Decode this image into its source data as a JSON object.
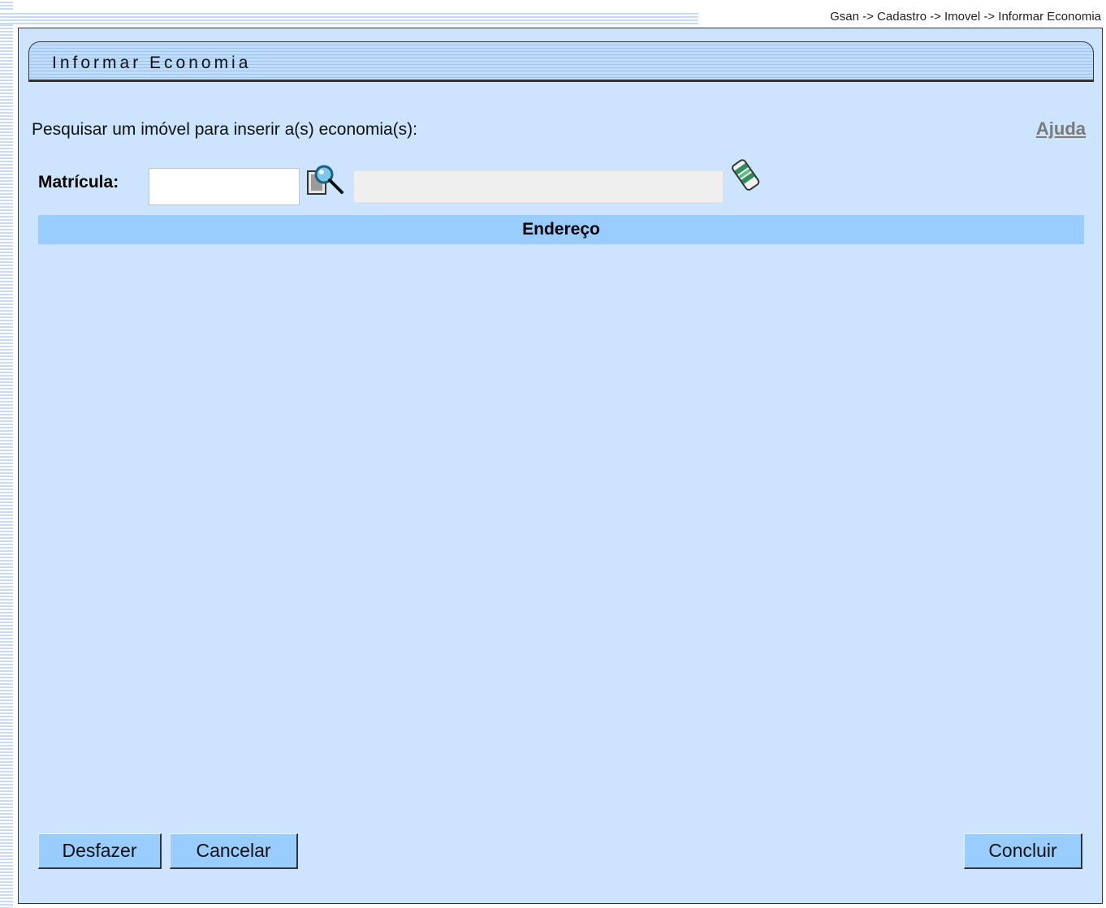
{
  "breadcrumb": "Gsan -> Cadastro -> Imovel -> Informar Economia",
  "panel": {
    "title": "Informar Economia"
  },
  "form": {
    "prompt": "Pesquisar um imóvel para inserir a(s) economia(s):",
    "help_link": "Ajuda",
    "matricula_label": "Matrícula:",
    "matricula_value": "",
    "matricula_description": ""
  },
  "table": {
    "header": "Endereço"
  },
  "buttons": {
    "undo": "Desfazer",
    "cancel": "Cancelar",
    "finish": "Concluir"
  },
  "icons": {
    "search": "search-magnifier-icon",
    "clear": "eraser-icon"
  },
  "colors": {
    "panel_bg": "#cce4fd",
    "header_bg": "#99ccff",
    "button_bg": "#99ccff",
    "link": "#7a7a7a"
  }
}
